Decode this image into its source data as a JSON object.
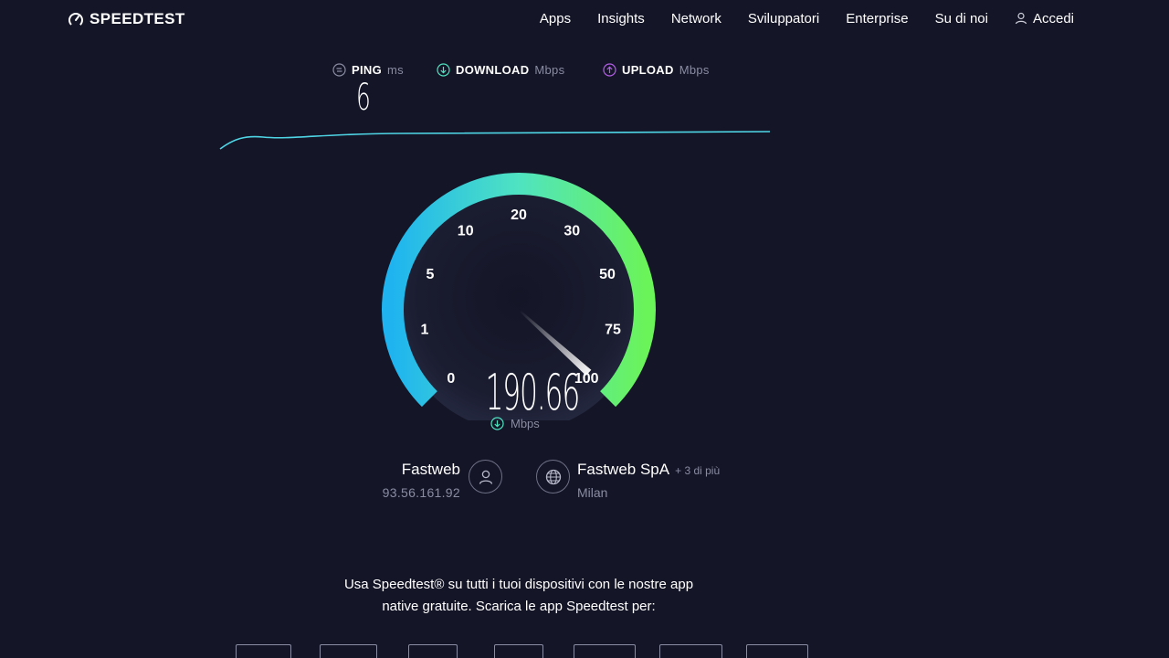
{
  "header": {
    "logo": "SPEEDTEST",
    "nav": [
      "Apps",
      "Insights",
      "Network",
      "Sviluppatori",
      "Enterprise",
      "Su di noi"
    ],
    "login": "Accedi"
  },
  "metrics": {
    "ping": {
      "label": "PING",
      "unit": "ms",
      "value": "6"
    },
    "download": {
      "label": "DOWNLOAD",
      "unit": "Mbps"
    },
    "upload": {
      "label": "UPLOAD",
      "unit": "Mbps"
    }
  },
  "gauge": {
    "ticks": [
      "0",
      "1",
      "5",
      "10",
      "20",
      "30",
      "50",
      "75",
      "100"
    ],
    "speed": "190.66",
    "unit": "Mbps",
    "colors": {
      "start": "#1fb4f0",
      "mid": "#4fe3c1",
      "end": "#6bf35a"
    }
  },
  "isp": {
    "name": "Fastweb",
    "ip": "93.56.161.92"
  },
  "server": {
    "name": "Fastweb SpA",
    "more": "+ 3 di più",
    "city": "Milan"
  },
  "promo": {
    "line1": "Usa Speedtest® su tutti i tuoi dispositivi con le nostre app",
    "line2": "native gratuite. Scarica le app Speedtest per:"
  }
}
